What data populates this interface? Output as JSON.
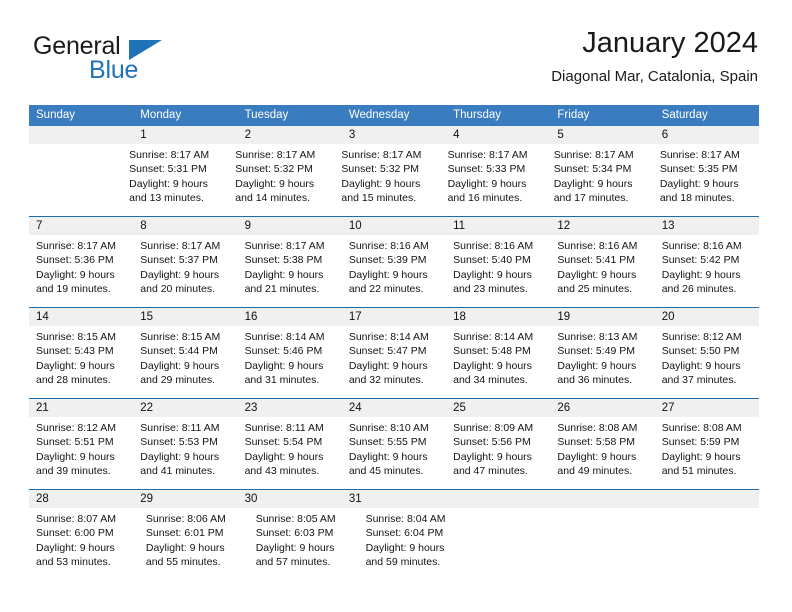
{
  "brand": {
    "name_part1": "General",
    "name_part2": "Blue",
    "accent_color": "#1f72b8"
  },
  "header": {
    "title": "January 2024",
    "subtitle": "Diagonal Mar, Catalonia, Spain"
  },
  "theme": {
    "header_blue": "#3a7cc0",
    "separator_blue": "#1f6cab",
    "number_band": "#f0f0f0",
    "body_bg": "#ffffff"
  },
  "weekdays": [
    "Sunday",
    "Monday",
    "Tuesday",
    "Wednesday",
    "Thursday",
    "Friday",
    "Saturday"
  ],
  "weeks": [
    {
      "days": [
        {
          "num": "",
          "lines": []
        },
        {
          "num": "1",
          "lines": [
            "Sunrise: 8:17 AM",
            "Sunset: 5:31 PM",
            "Daylight: 9 hours",
            "and 13 minutes."
          ]
        },
        {
          "num": "2",
          "lines": [
            "Sunrise: 8:17 AM",
            "Sunset: 5:32 PM",
            "Daylight: 9 hours",
            "and 14 minutes."
          ]
        },
        {
          "num": "3",
          "lines": [
            "Sunrise: 8:17 AM",
            "Sunset: 5:32 PM",
            "Daylight: 9 hours",
            "and 15 minutes."
          ]
        },
        {
          "num": "4",
          "lines": [
            "Sunrise: 8:17 AM",
            "Sunset: 5:33 PM",
            "Daylight: 9 hours",
            "and 16 minutes."
          ]
        },
        {
          "num": "5",
          "lines": [
            "Sunrise: 8:17 AM",
            "Sunset: 5:34 PM",
            "Daylight: 9 hours",
            "and 17 minutes."
          ]
        },
        {
          "num": "6",
          "lines": [
            "Sunrise: 8:17 AM",
            "Sunset: 5:35 PM",
            "Daylight: 9 hours",
            "and 18 minutes."
          ]
        }
      ]
    },
    {
      "days": [
        {
          "num": "7",
          "lines": [
            "Sunrise: 8:17 AM",
            "Sunset: 5:36 PM",
            "Daylight: 9 hours",
            "and 19 minutes."
          ]
        },
        {
          "num": "8",
          "lines": [
            "Sunrise: 8:17 AM",
            "Sunset: 5:37 PM",
            "Daylight: 9 hours",
            "and 20 minutes."
          ]
        },
        {
          "num": "9",
          "lines": [
            "Sunrise: 8:17 AM",
            "Sunset: 5:38 PM",
            "Daylight: 9 hours",
            "and 21 minutes."
          ]
        },
        {
          "num": "10",
          "lines": [
            "Sunrise: 8:16 AM",
            "Sunset: 5:39 PM",
            "Daylight: 9 hours",
            "and 22 minutes."
          ]
        },
        {
          "num": "11",
          "lines": [
            "Sunrise: 8:16 AM",
            "Sunset: 5:40 PM",
            "Daylight: 9 hours",
            "and 23 minutes."
          ]
        },
        {
          "num": "12",
          "lines": [
            "Sunrise: 8:16 AM",
            "Sunset: 5:41 PM",
            "Daylight: 9 hours",
            "and 25 minutes."
          ]
        },
        {
          "num": "13",
          "lines": [
            "Sunrise: 8:16 AM",
            "Sunset: 5:42 PM",
            "Daylight: 9 hours",
            "and 26 minutes."
          ]
        }
      ]
    },
    {
      "days": [
        {
          "num": "14",
          "lines": [
            "Sunrise: 8:15 AM",
            "Sunset: 5:43 PM",
            "Daylight: 9 hours",
            "and 28 minutes."
          ]
        },
        {
          "num": "15",
          "lines": [
            "Sunrise: 8:15 AM",
            "Sunset: 5:44 PM",
            "Daylight: 9 hours",
            "and 29 minutes."
          ]
        },
        {
          "num": "16",
          "lines": [
            "Sunrise: 8:14 AM",
            "Sunset: 5:46 PM",
            "Daylight: 9 hours",
            "and 31 minutes."
          ]
        },
        {
          "num": "17",
          "lines": [
            "Sunrise: 8:14 AM",
            "Sunset: 5:47 PM",
            "Daylight: 9 hours",
            "and 32 minutes."
          ]
        },
        {
          "num": "18",
          "lines": [
            "Sunrise: 8:14 AM",
            "Sunset: 5:48 PM",
            "Daylight: 9 hours",
            "and 34 minutes."
          ]
        },
        {
          "num": "19",
          "lines": [
            "Sunrise: 8:13 AM",
            "Sunset: 5:49 PM",
            "Daylight: 9 hours",
            "and 36 minutes."
          ]
        },
        {
          "num": "20",
          "lines": [
            "Sunrise: 8:12 AM",
            "Sunset: 5:50 PM",
            "Daylight: 9 hours",
            "and 37 minutes."
          ]
        }
      ]
    },
    {
      "days": [
        {
          "num": "21",
          "lines": [
            "Sunrise: 8:12 AM",
            "Sunset: 5:51 PM",
            "Daylight: 9 hours",
            "and 39 minutes."
          ]
        },
        {
          "num": "22",
          "lines": [
            "Sunrise: 8:11 AM",
            "Sunset: 5:53 PM",
            "Daylight: 9 hours",
            "and 41 minutes."
          ]
        },
        {
          "num": "23",
          "lines": [
            "Sunrise: 8:11 AM",
            "Sunset: 5:54 PM",
            "Daylight: 9 hours",
            "and 43 minutes."
          ]
        },
        {
          "num": "24",
          "lines": [
            "Sunrise: 8:10 AM",
            "Sunset: 5:55 PM",
            "Daylight: 9 hours",
            "and 45 minutes."
          ]
        },
        {
          "num": "25",
          "lines": [
            "Sunrise: 8:09 AM",
            "Sunset: 5:56 PM",
            "Daylight: 9 hours",
            "and 47 minutes."
          ]
        },
        {
          "num": "26",
          "lines": [
            "Sunrise: 8:08 AM",
            "Sunset: 5:58 PM",
            "Daylight: 9 hours",
            "and 49 minutes."
          ]
        },
        {
          "num": "27",
          "lines": [
            "Sunrise: 8:08 AM",
            "Sunset: 5:59 PM",
            "Daylight: 9 hours",
            "and 51 minutes."
          ]
        }
      ]
    },
    {
      "days": [
        {
          "num": "28",
          "lines": [
            "Sunrise: 8:07 AM",
            "Sunset: 6:00 PM",
            "Daylight: 9 hours",
            "and 53 minutes."
          ]
        },
        {
          "num": "29",
          "lines": [
            "Sunrise: 8:06 AM",
            "Sunset: 6:01 PM",
            "Daylight: 9 hours",
            "and 55 minutes."
          ]
        },
        {
          "num": "30",
          "lines": [
            "Sunrise: 8:05 AM",
            "Sunset: 6:03 PM",
            "Daylight: 9 hours",
            "and 57 minutes."
          ]
        },
        {
          "num": "31",
          "lines": [
            "Sunrise: 8:04 AM",
            "Sunset: 6:04 PM",
            "Daylight: 9 hours",
            "and 59 minutes."
          ]
        },
        {
          "num": "",
          "lines": []
        },
        {
          "num": "",
          "lines": []
        },
        {
          "num": "",
          "lines": []
        }
      ]
    }
  ]
}
